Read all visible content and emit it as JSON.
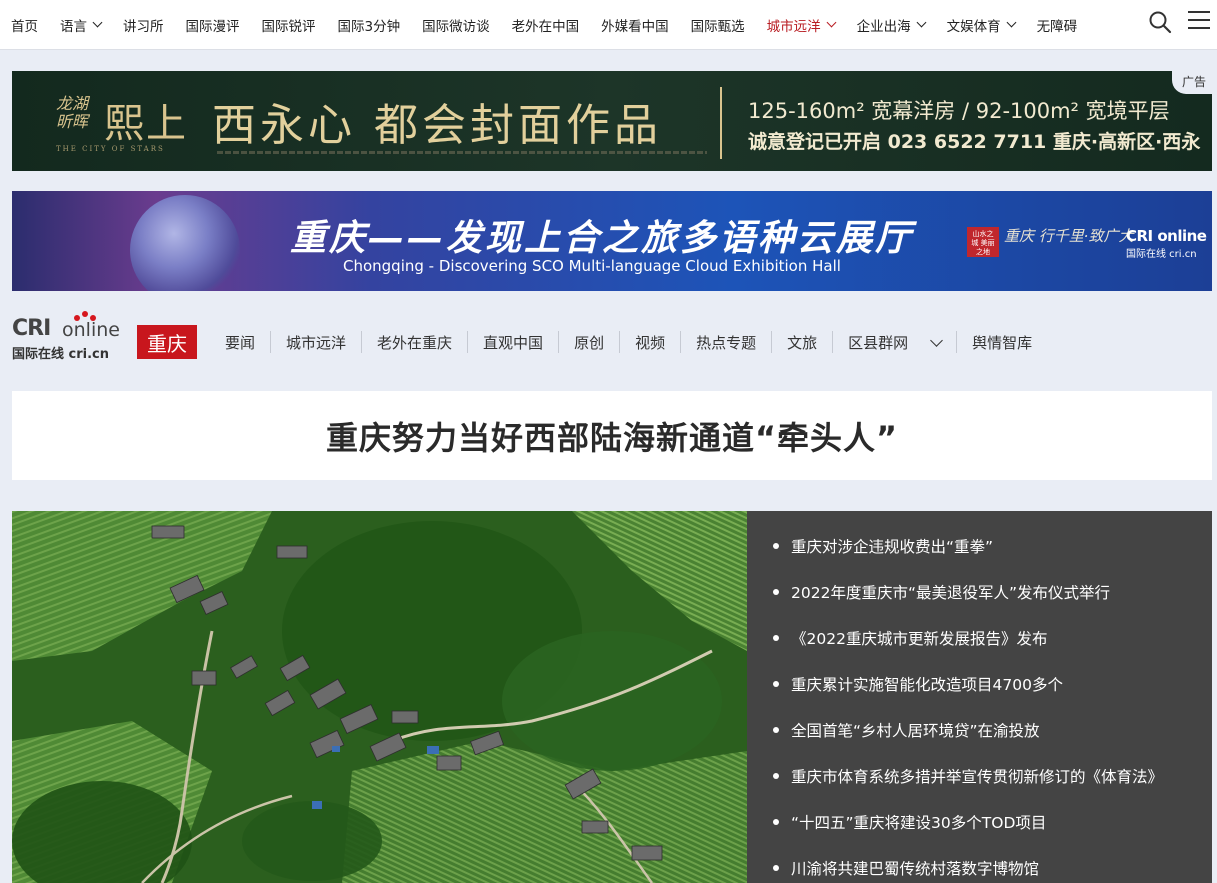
{
  "topnav": {
    "items": [
      {
        "label": "首页",
        "dropdown": false
      },
      {
        "label": "语言",
        "dropdown": true
      },
      {
        "label": "讲习所",
        "dropdown": false
      },
      {
        "label": "国际漫评",
        "dropdown": false
      },
      {
        "label": "国际锐评",
        "dropdown": false
      },
      {
        "label": "国际3分钟",
        "dropdown": false
      },
      {
        "label": "国际微访谈",
        "dropdown": false
      },
      {
        "label": "老外在中国",
        "dropdown": false
      },
      {
        "label": "外媒看中国",
        "dropdown": false
      },
      {
        "label": "国际甄选",
        "dropdown": false
      },
      {
        "label": "城市远洋",
        "dropdown": true,
        "active": true
      },
      {
        "label": "企业出海",
        "dropdown": true
      },
      {
        "label": "文娱体育",
        "dropdown": true
      },
      {
        "label": "无障碍",
        "dropdown": false
      }
    ],
    "search_icon": "search-icon",
    "menu_icon": "hamburger-menu-icon",
    "active_color": "#b81c22"
  },
  "ad1": {
    "brand_small": "龙湖\n昕晖",
    "brand_big": "熙上",
    "brand_sub": "THE CITY OF STARS",
    "headline": "西永心 都会封面作品",
    "line1": "125-160m² 宽幕洋房 / 92-100m² 宽境平层",
    "line2": "诚意登记已开启 023 6522 7711 重庆·高新区·西永",
    "tag": "广告"
  },
  "ad2": {
    "title": "重庆——发现上合之旅多语种云展厅",
    "subtitle": "Chongqing - Discovering SCO Multi-language Cloud Exhibition Hall",
    "stamp": "山水之城 美丽之地",
    "slogan": "重庆 行千里·致广大",
    "logo_line1": "CRI online",
    "logo_line2": "国际在线 cri.cn"
  },
  "channel": {
    "logo_cri": "CRI",
    "logo_online": "online",
    "logo_sub": "国际在线 cri.cn",
    "badge": "重庆",
    "nav": [
      "要闻",
      "城市远洋",
      "老外在重庆",
      "直观中国",
      "原创",
      "视频",
      "热点专题",
      "文旅",
      "区县群网",
      "舆情智库"
    ],
    "accent": "#c8161d"
  },
  "article": {
    "headline": "重庆努力当好西部陆海新通道“牵头人”"
  },
  "sidebar_news": [
    "重庆对涉企违规收费出“重拳”",
    "2022年度重庆市“最美退役军人”发布仪式举行",
    "《2022重庆城市更新发展报告》发布",
    "重庆累计实施智能化改造项目4700多个",
    "全国首笔“乡村人居环境贷”在渝投放",
    "重庆市体育系统多措并举宣传贯彻新修订的《体育法》",
    "“十四五”重庆将建设30多个TOD项目",
    "川渝将共建巴蜀传统村落数字博物馆"
  ]
}
